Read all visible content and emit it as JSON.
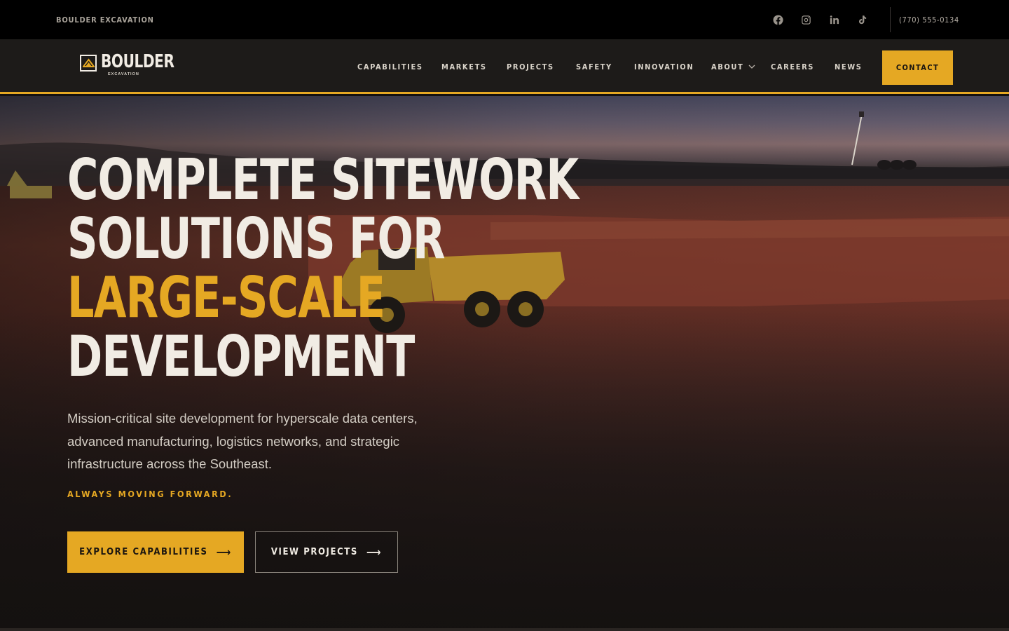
{
  "topbar": {
    "brand": "BOULDER EXCAVATION",
    "socials": [
      {
        "icon": "facebook-icon"
      },
      {
        "icon": "instagram-icon"
      },
      {
        "icon": "linkedin-icon"
      },
      {
        "icon": "tiktok-icon"
      }
    ],
    "phone": "(770) 555-0134"
  },
  "nav": {
    "logo_word": "BOULDER",
    "logo_sub": "EXCAVATION",
    "items": [
      {
        "label": "CAPABILITIES"
      },
      {
        "label": "MARKETS"
      },
      {
        "label": "PROJECTS"
      },
      {
        "label": "SAFETY"
      },
      {
        "label": "INNOVATION"
      },
      {
        "label": "ABOUT",
        "dropdown": true
      },
      {
        "label": "CAREERS"
      },
      {
        "label": "NEWS"
      }
    ],
    "contact": "CONTACT"
  },
  "hero": {
    "headline": {
      "line1": "COMPLETE SITEWORK",
      "line2": "SOLUTIONS FOR",
      "line3": "LARGE-SCALE",
      "line4": "DEVELOPMENT"
    },
    "subtext": "Mission-critical site development for hyperscale data centers, advanced manufacturing, logistics networks, and strategic infrastructure across the Southeast.",
    "tagline": "ALWAYS MOVING FORWARD.",
    "primary_cta": "EXPLORE CAPABILITIES",
    "secondary_cta": "VIEW PROJECTS",
    "arrow": "⟶"
  },
  "colors": {
    "accent": "#e5a823",
    "topbar_bg": "#000000",
    "nav_bg": "#1d1b19",
    "text_light": "#f1ece4"
  }
}
